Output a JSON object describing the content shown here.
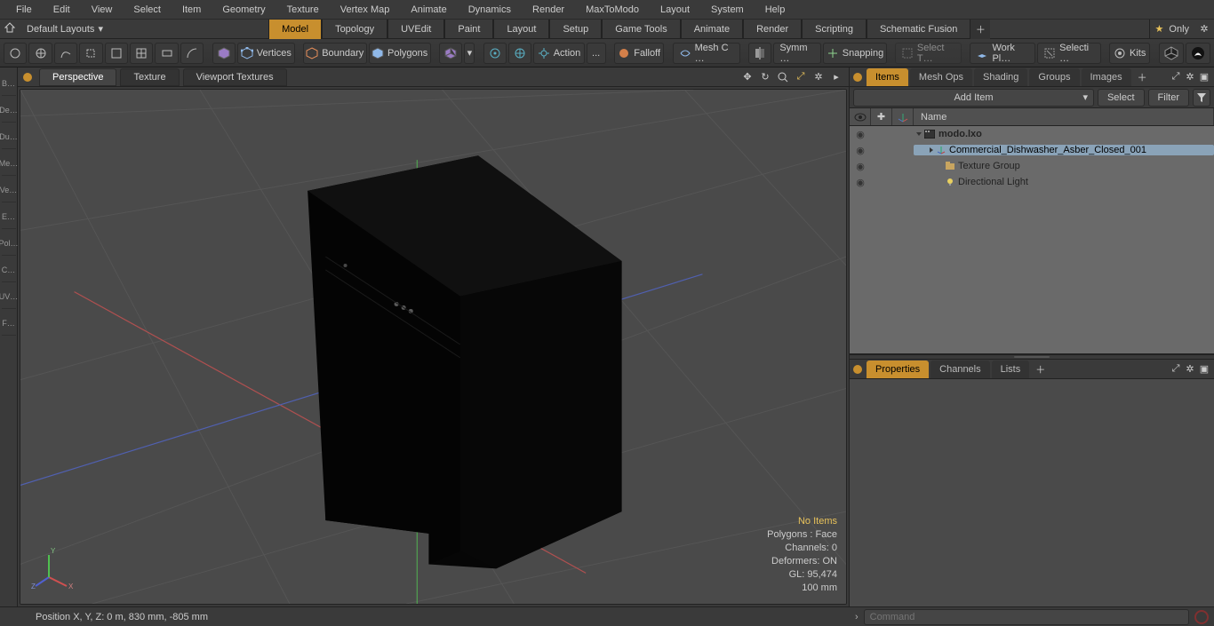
{
  "menu": [
    "File",
    "Edit",
    "View",
    "Select",
    "Item",
    "Geometry",
    "Texture",
    "Vertex Map",
    "Animate",
    "Dynamics",
    "Render",
    "MaxToModo",
    "Layout",
    "System",
    "Help"
  ],
  "layoutRow": {
    "dropdown": "Default Layouts",
    "tabs": [
      "Model",
      "Topology",
      "UVEdit",
      "Paint",
      "Layout",
      "Setup",
      "Game Tools",
      "Animate",
      "Render",
      "Scripting",
      "Schematic Fusion"
    ],
    "active": "Model",
    "only": "Only"
  },
  "toolbar": {
    "vertices": "Vertices",
    "boundary": "Boundary",
    "polygons": "Polygons",
    "action": "Action",
    "actionDots": "...",
    "falloff": "Falloff",
    "meshc": "Mesh C …",
    "symm": "Symm …",
    "snapping": "Snapping",
    "selectT": "Select T…",
    "workpl": "Work Pl…",
    "selecti": "Selecti …",
    "kits": "Kits"
  },
  "viewportTabs": [
    "Perspective",
    "Texture",
    "Viewport Textures"
  ],
  "viewportActive": "Perspective",
  "readout": {
    "noItems": "No Items",
    "polygons": "Polygons : Face",
    "channels": "Channels: 0",
    "deformers": "Deformers: ON",
    "gl": "GL: 95,474",
    "grid": "100 mm"
  },
  "status": {
    "pos": "Position X, Y, Z:   0 m, 830 mm, -805 mm",
    "cmdPlaceholder": "Command"
  },
  "itemsPanel": {
    "tabs": [
      "Items",
      "Mesh Ops",
      "Shading",
      "Groups",
      "Images"
    ],
    "active": "Items",
    "addItem": "Add Item",
    "select": "Select",
    "filter": "Filter",
    "nameHeader": "Name",
    "tree": {
      "root": "modo.lxo",
      "children": [
        {
          "label": "Commercial_Dishwasher_Asber_Closed_001",
          "icon": "mesh",
          "selected": true
        },
        {
          "label": "Texture Group",
          "icon": "group"
        },
        {
          "label": "Directional Light",
          "icon": "light"
        }
      ]
    }
  },
  "propPanel": {
    "tabs": [
      "Properties",
      "Channels",
      "Lists"
    ],
    "active": "Properties"
  },
  "leftGutter": [
    "B…",
    "De…",
    "Du…",
    "Me…",
    "Ve…",
    "E…",
    "Pol…",
    "C…",
    "UV…",
    "F…"
  ]
}
